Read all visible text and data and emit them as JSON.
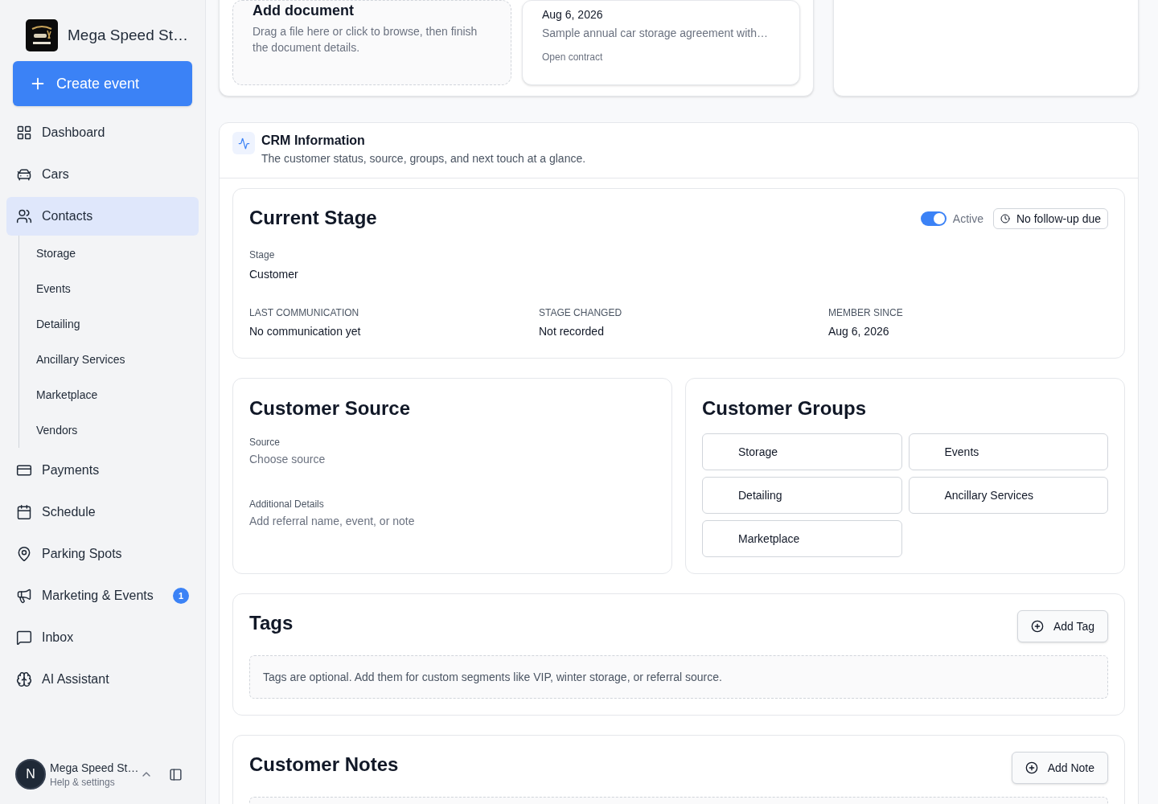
{
  "sidebar": {
    "brand": "Mega Speed St…",
    "create_button": "Create event",
    "nav": [
      {
        "label": "Dashboard",
        "selected": false
      },
      {
        "label": "Cars",
        "selected": false
      },
      {
        "label": "Contacts",
        "selected": true,
        "children": [
          {
            "label": "Storage",
            "selected": false
          },
          {
            "label": "Events",
            "selected": false
          },
          {
            "label": "Detailing",
            "selected": false
          },
          {
            "label": "Ancillary Services",
            "selected": false
          },
          {
            "label": "Marketplace",
            "selected": false
          },
          {
            "label": "Vendors",
            "selected": false
          }
        ]
      },
      {
        "label": "Payments",
        "selected": false
      },
      {
        "label": "Schedule",
        "selected": false
      },
      {
        "label": "Parking Spots",
        "selected": false
      },
      {
        "label": "Marketing & Events",
        "selected": false,
        "badge": "1"
      },
      {
        "label": "Inbox",
        "selected": false
      },
      {
        "label": "AI Assistant",
        "selected": false
      }
    ],
    "account": {
      "avatar": "N",
      "name": "Mega Speed St…",
      "subtitle": "Help & settings"
    }
  },
  "documents": {
    "upload": {
      "title": "Add document",
      "hint": "Drag a file here or click to browse, then finish the document details."
    },
    "contract": {
      "date": "Aug 6, 2026",
      "description": "Sample annual car storage agreement with…",
      "link": "Open contract"
    }
  },
  "crm": {
    "title": "CRM Information",
    "subtitle": "The customer status, source, groups, and next touch at a glance.",
    "current_stage": {
      "title": "Current Stage",
      "active": {
        "label": "Active",
        "on": true
      },
      "follow_up": "No follow-up due",
      "stage_label": "Stage",
      "stage_value": "Customer",
      "facts": [
        {
          "label": "LAST COMMUNICATION",
          "value": "No communication yet"
        },
        {
          "label": "STAGE CHANGED",
          "value": "Not recorded"
        },
        {
          "label": "MEMBER SINCE",
          "value": "Aug 6, 2026"
        }
      ]
    },
    "source": {
      "title": "Customer Source",
      "fields": [
        {
          "label": "Source",
          "placeholder": "Choose source"
        },
        {
          "label": "Additional Details",
          "placeholder": "Add referral name, event, or note"
        }
      ]
    },
    "groups": {
      "title": "Customer Groups",
      "items": [
        {
          "label": "Storage",
          "selected": false
        },
        {
          "label": "Events",
          "selected": false
        },
        {
          "label": "Detailing",
          "selected": false
        },
        {
          "label": "Ancillary Services",
          "selected": false
        },
        {
          "label": "Marketplace",
          "selected": false
        }
      ]
    },
    "tags": {
      "title": "Tags",
      "button": "Add Tag",
      "empty": "Tags are optional. Add them for custom segments like VIP, winter storage, or referral source."
    },
    "notes": {
      "title": "Customer Notes",
      "button": "Add Note"
    }
  }
}
